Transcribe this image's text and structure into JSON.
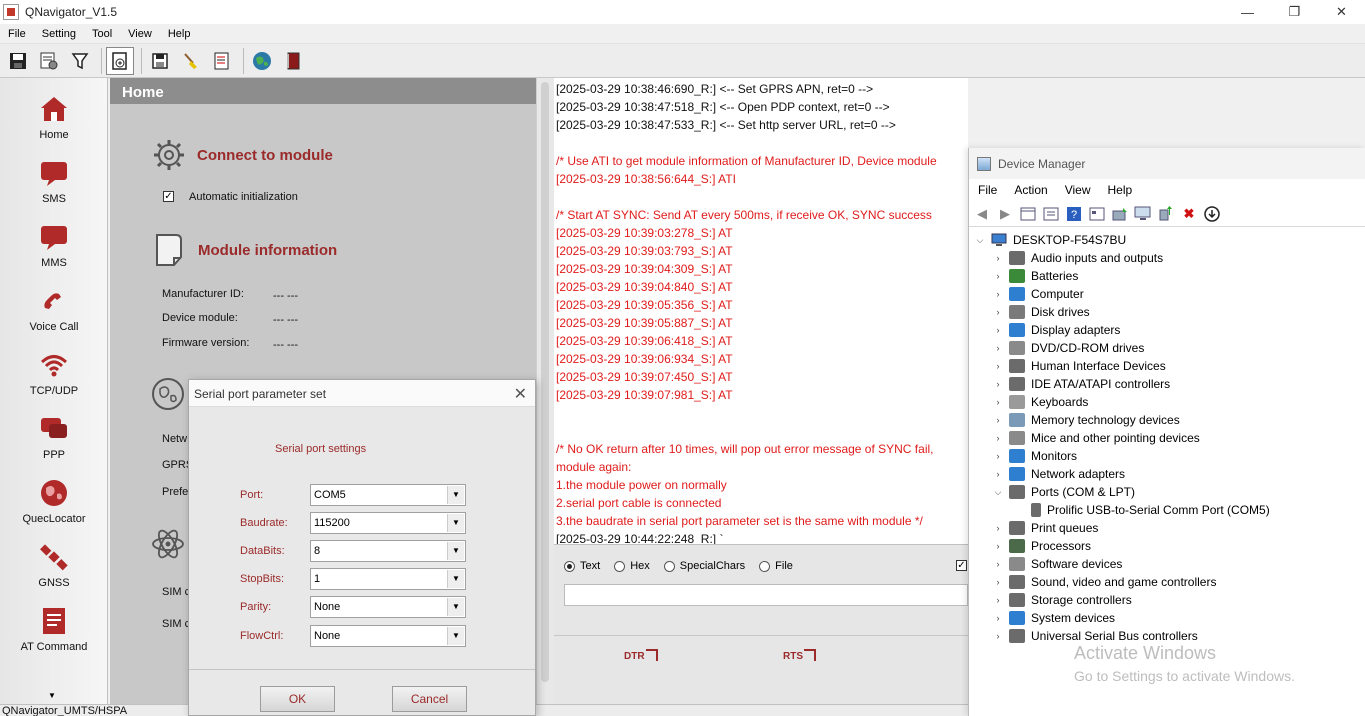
{
  "app": {
    "title": "QNavigator_V1.5",
    "window_controls": [
      "—",
      "❐",
      "✕"
    ]
  },
  "menubar": [
    "File",
    "Setting",
    "Tool",
    "View",
    "Help"
  ],
  "toolbar_icons": [
    "save-icon",
    "settings-icon",
    "filter-icon",
    "new-page-icon",
    "export-icon",
    "clear-icon",
    "log-icon",
    "globe-icon",
    "book-icon"
  ],
  "sidebar": [
    {
      "label": "Home",
      "icon": "home-icon"
    },
    {
      "label": "SMS",
      "icon": "sms-icon"
    },
    {
      "label": "MMS",
      "icon": "mms-icon"
    },
    {
      "label": "Voice Call",
      "icon": "phone-icon"
    },
    {
      "label": "TCP/UDP",
      "icon": "wifi-icon"
    },
    {
      "label": "PPP",
      "icon": "ppp-icon"
    },
    {
      "label": "QuecLocator",
      "icon": "globe-icon"
    },
    {
      "label": "GNSS",
      "icon": "satellite-icon"
    },
    {
      "label": "AT Command",
      "icon": "at-command-icon"
    }
  ],
  "home": {
    "header": "Home",
    "connect_title": "Connect to module",
    "auto_init_label": "Automatic initialization",
    "auto_init_checked": "✓",
    "module_info_title": "Module information",
    "manufacturer_label": "Manufacturer ID:",
    "manufacturer_value": "--- ---",
    "device_label": "Device module:",
    "device_value": "--- ---",
    "firmware_label": "Firmware version:",
    "firmware_value": "--- ---",
    "netw_label": "Netw",
    "gprs_label": "GPRS",
    "prefe_label": "Prefe",
    "sim1_label": "SIM c",
    "sim2_label": "SIM c"
  },
  "dialog": {
    "title": "Serial port parameter set",
    "group_title": "Serial port settings",
    "fields": [
      {
        "label": "Port:",
        "value": "COM5"
      },
      {
        "label": "Baudrate:",
        "value": "115200"
      },
      {
        "label": "DataBits:",
        "value": "8"
      },
      {
        "label": "StopBits:",
        "value": "1"
      },
      {
        "label": "Parity:",
        "value": "None"
      },
      {
        "label": "FlowCtrl:",
        "value": "None"
      }
    ],
    "ok_label": "OK",
    "cancel_label": "Cancel"
  },
  "log_lines": [
    {
      "text": "[2025-03-29 10:38:46:690_R:] <-- Set GPRS APN, ret=0 -->",
      "color": "black"
    },
    {
      "text": "[2025-03-29 10:38:47:518_R:] <-- Open PDP context, ret=0 -->",
      "color": "black"
    },
    {
      "text": "[2025-03-29 10:38:47:533_R:] <-- Set http server URL, ret=0 -->",
      "color": "black"
    },
    {
      "text": "",
      "color": "black"
    },
    {
      "text": "/* Use ATI to get module information of Manufacturer ID, Device module",
      "color": "red"
    },
    {
      "text": "[2025-03-29 10:38:56:644_S:] ATI",
      "color": "red"
    },
    {
      "text": "",
      "color": "black"
    },
    {
      "text": "/* Start AT SYNC: Send AT every 500ms, if receive OK, SYNC success",
      "color": "red"
    },
    {
      "text": "[2025-03-29 10:39:03:278_S:] AT",
      "color": "red"
    },
    {
      "text": "[2025-03-29 10:39:03:793_S:] AT",
      "color": "red"
    },
    {
      "text": "[2025-03-29 10:39:04:309_S:] AT",
      "color": "red"
    },
    {
      "text": "[2025-03-29 10:39:04:840_S:] AT",
      "color": "red"
    },
    {
      "text": "[2025-03-29 10:39:05:356_S:] AT",
      "color": "red"
    },
    {
      "text": "[2025-03-29 10:39:05:887_S:] AT",
      "color": "red"
    },
    {
      "text": "[2025-03-29 10:39:06:418_S:] AT",
      "color": "red"
    },
    {
      "text": "[2025-03-29 10:39:06:934_S:] AT",
      "color": "red"
    },
    {
      "text": "[2025-03-29 10:39:07:450_S:] AT",
      "color": "red"
    },
    {
      "text": "[2025-03-29 10:39:07:981_S:] AT",
      "color": "red"
    },
    {
      "text": "",
      "color": "black"
    },
    {
      "text": "",
      "color": "black"
    },
    {
      "text": "/* No OK return after 10 times, will pop out error message of SYNC fail,",
      "color": "red"
    },
    {
      "text": "module again:",
      "color": "red"
    },
    {
      "text": " 1.the module power on normally",
      "color": "red"
    },
    {
      "text": " 2.serial port cable is connected",
      "color": "red"
    },
    {
      "text": " 3.the baudrate in serial port parameter set is the same with module */",
      "color": "red"
    },
    {
      "text": "[2025-03-29 10:44:22:248_R:] `",
      "color": "black"
    }
  ],
  "send": {
    "modes": [
      {
        "label": "Text",
        "selected": true
      },
      {
        "label": "Hex",
        "selected": false
      },
      {
        "label": "SpecialChars",
        "selected": false
      },
      {
        "label": "File",
        "selected": false
      }
    ],
    "send_checked": "✓",
    "dtr_label": "DTR",
    "rts_label": "RTS"
  },
  "statusbar": {
    "text": "QNavigator_UMTS/HSPA"
  },
  "device_manager": {
    "title": "Device Manager",
    "menu": [
      "File",
      "Action",
      "View",
      "Help"
    ],
    "root": "DESKTOP-F54S7BU",
    "categories": [
      {
        "label": "Audio inputs and outputs",
        "color": "#6b6b6b",
        "expanded": false
      },
      {
        "label": "Batteries",
        "color": "#3a8a3a",
        "expanded": false
      },
      {
        "label": "Computer",
        "color": "#2f7fd0",
        "expanded": false
      },
      {
        "label": "Disk drives",
        "color": "#7a7a7a",
        "expanded": false
      },
      {
        "label": "Display adapters",
        "color": "#2f7fd0",
        "expanded": false
      },
      {
        "label": "DVD/CD-ROM drives",
        "color": "#8a8a8a",
        "expanded": false
      },
      {
        "label": "Human Interface Devices",
        "color": "#6b6b6b",
        "expanded": false
      },
      {
        "label": "IDE ATA/ATAPI controllers",
        "color": "#6b6b6b",
        "expanded": false
      },
      {
        "label": "Keyboards",
        "color": "#9a9a9a",
        "expanded": false
      },
      {
        "label": "Memory technology devices",
        "color": "#7a9ab8",
        "expanded": false
      },
      {
        "label": "Mice and other pointing devices",
        "color": "#8a8a8a",
        "expanded": false
      },
      {
        "label": "Monitors",
        "color": "#2f7fd0",
        "expanded": false
      },
      {
        "label": "Network adapters",
        "color": "#2f7fd0",
        "expanded": false
      },
      {
        "label": "Ports (COM & LPT)",
        "color": "#6b6b6b",
        "expanded": true
      },
      {
        "label": "Print queues",
        "color": "#6b6b6b",
        "expanded": false
      },
      {
        "label": "Processors",
        "color": "#4a6a4a",
        "expanded": false
      },
      {
        "label": "Software devices",
        "color": "#8a8a8a",
        "expanded": false
      },
      {
        "label": "Sound, video and game controllers",
        "color": "#6b6b6b",
        "expanded": false
      },
      {
        "label": "Storage controllers",
        "color": "#6b6b6b",
        "expanded": false
      },
      {
        "label": "System devices",
        "color": "#2f7fd0",
        "expanded": false
      },
      {
        "label": "Universal Serial Bus controllers",
        "color": "#6b6b6b",
        "expanded": false
      }
    ],
    "port_child": "Prolific USB-to-Serial Comm Port (COM5)",
    "watermark_title": "Activate Windows",
    "watermark_sub": "Go to Settings to activate Windows."
  },
  "colors": {
    "accent_red": "#9b2a2a",
    "log_red": "#e01b1b",
    "panel_gray": "#c8c8c8"
  }
}
